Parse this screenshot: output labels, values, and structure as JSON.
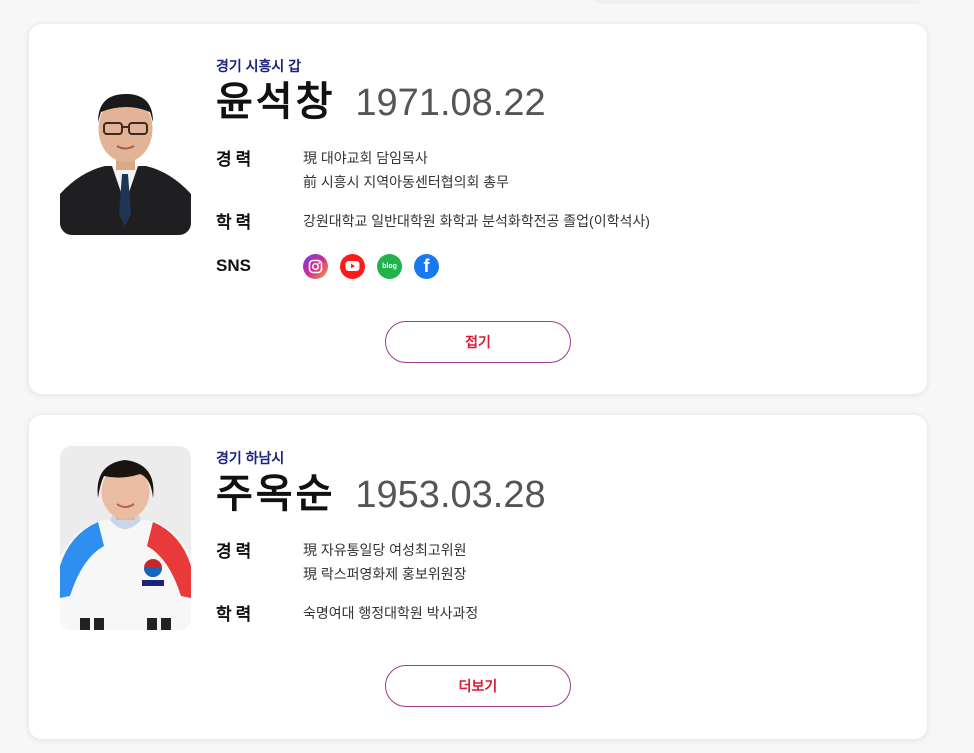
{
  "candidates": [
    {
      "district": "경기 시흥시 갑",
      "name": "윤석창",
      "birth": "1971.08.22",
      "career_label": "경력",
      "career": [
        "現 대야교회 담임목사",
        "前 시흥시 지역아동센터협의회 총무"
      ],
      "education_label": "학력",
      "education": [
        "강원대학교 일반대학원 화학과 분석화학전공 졸업(이학석사)"
      ],
      "sns_label": "SNS",
      "sns": [
        {
          "name": "instagram-icon"
        },
        {
          "name": "youtube-icon"
        },
        {
          "name": "blog-icon",
          "text": "blog"
        },
        {
          "name": "facebook-icon",
          "text": "f"
        }
      ],
      "toggle_label": "접기"
    },
    {
      "district": "경기 하남시",
      "name": "주옥순",
      "birth": "1953.03.28",
      "career_label": "경력",
      "career": [
        "現 자유통일당 여성최고위원",
        "現 락스퍼영화제 홍보위원장"
      ],
      "education_label": "학력",
      "education": [
        "숙명여대 행정대학원 박사과정"
      ],
      "toggle_label": "더보기"
    }
  ],
  "colors": {
    "district": "#1a237e",
    "button_text": "#d81b38",
    "button_border": "#9c3c8c"
  }
}
